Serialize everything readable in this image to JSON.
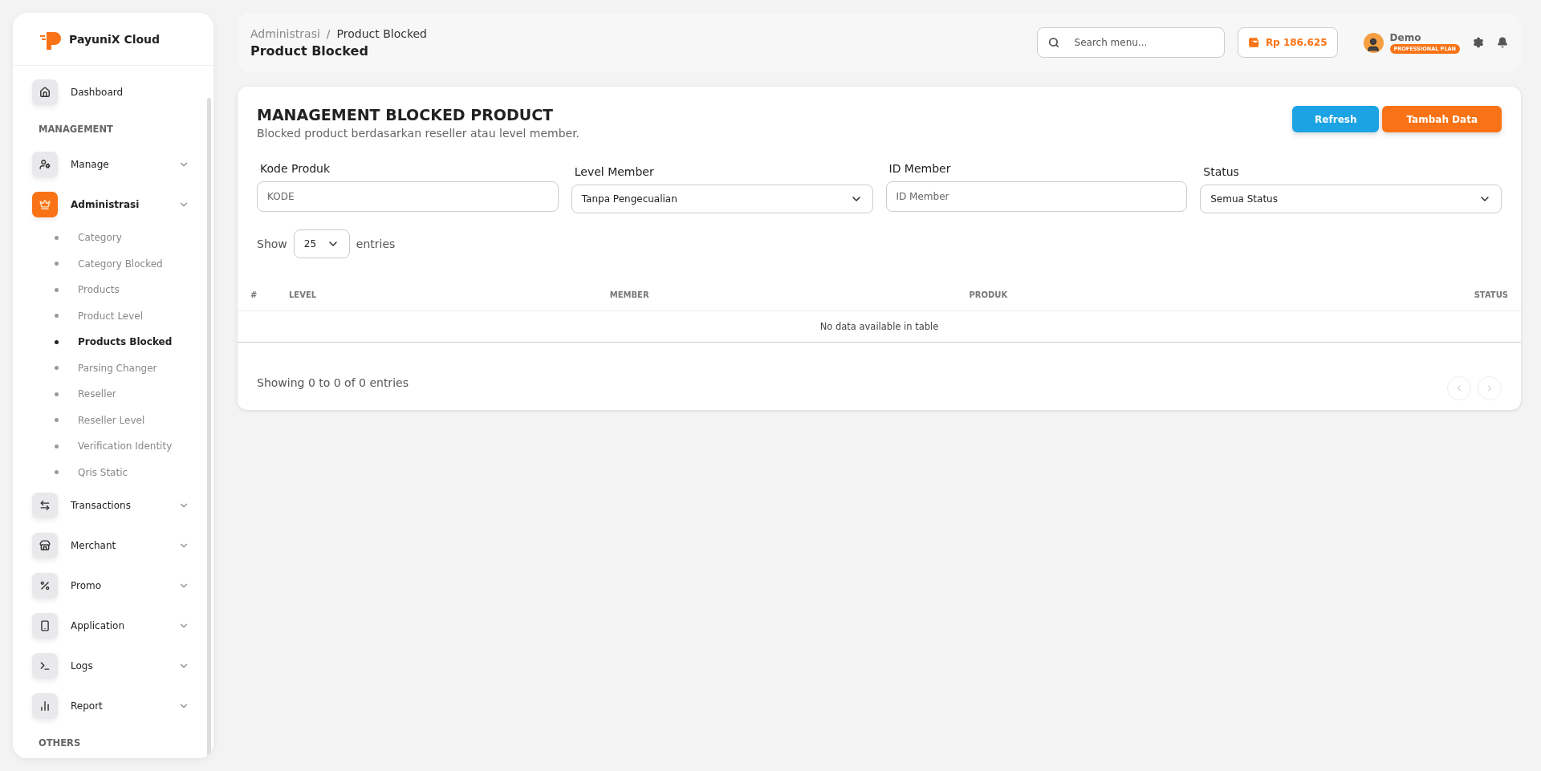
{
  "brand": "PayuniX Cloud",
  "sidebar": {
    "items": [
      {
        "kind": "link",
        "label": "Dashboard",
        "active": false
      },
      {
        "kind": "section",
        "label": "MANAGEMENT"
      },
      {
        "kind": "group",
        "label": "Manage",
        "active": false
      },
      {
        "kind": "group",
        "label": "Administrasi",
        "active": true,
        "children": [
          {
            "label": "Category",
            "selected": false
          },
          {
            "label": "Category Blocked",
            "selected": false
          },
          {
            "label": "Products",
            "selected": false
          },
          {
            "label": "Product Level",
            "selected": false
          },
          {
            "label": "Products Blocked",
            "selected": true
          },
          {
            "label": "Parsing Changer",
            "selected": false
          },
          {
            "label": "Reseller",
            "selected": false
          },
          {
            "label": "Reseller Level",
            "selected": false
          },
          {
            "label": "Verification Identity",
            "selected": false
          },
          {
            "label": "Qris Static",
            "selected": false
          }
        ]
      },
      {
        "kind": "group",
        "label": "Transactions",
        "active": false
      },
      {
        "kind": "group",
        "label": "Merchant",
        "active": false
      },
      {
        "kind": "group",
        "label": "Promo",
        "active": false
      },
      {
        "kind": "group",
        "label": "Application",
        "active": false
      },
      {
        "kind": "group",
        "label": "Logs",
        "active": false
      },
      {
        "kind": "group",
        "label": "Report",
        "active": false
      },
      {
        "kind": "section",
        "label": "OTHERS"
      }
    ]
  },
  "header": {
    "breadcrumb": [
      "Administrasi",
      "/",
      "Product Blocked"
    ],
    "title": "Product Blocked",
    "search": {
      "placeholder": "Search menu..."
    },
    "balance": "Rp 186.625",
    "user": {
      "name": "Demo",
      "plan": "PROFESSIONAL PLAN"
    }
  },
  "card": {
    "title": "MANAGEMENT BLOCKED PRODUCT",
    "subtitle": "Blocked product berdasarkan reseller atau level member.",
    "buttons": [
      {
        "label": "Refresh",
        "kind": "info"
      },
      {
        "label": "Tambah Data",
        "kind": "primary"
      }
    ],
    "filters": [
      {
        "kind": "input",
        "label": "Kode Produk",
        "placeholder": "KODE"
      },
      {
        "kind": "select",
        "label": "Level Member",
        "value": "Tanpa Pengecualian"
      },
      {
        "kind": "input",
        "label": "ID Member",
        "placeholder": "ID Member"
      },
      {
        "kind": "select",
        "label": "Status",
        "value": "Semua Status"
      }
    ],
    "length": {
      "prefix": "Show",
      "value": "25",
      "suffix": "entries"
    },
    "table": {
      "columns": [
        "#",
        "LEVEL",
        "MEMBER",
        "PRODUK",
        "STATUS"
      ],
      "empty": "No data available in table"
    },
    "info": "Showing 0 to 0 of 0 entries"
  }
}
